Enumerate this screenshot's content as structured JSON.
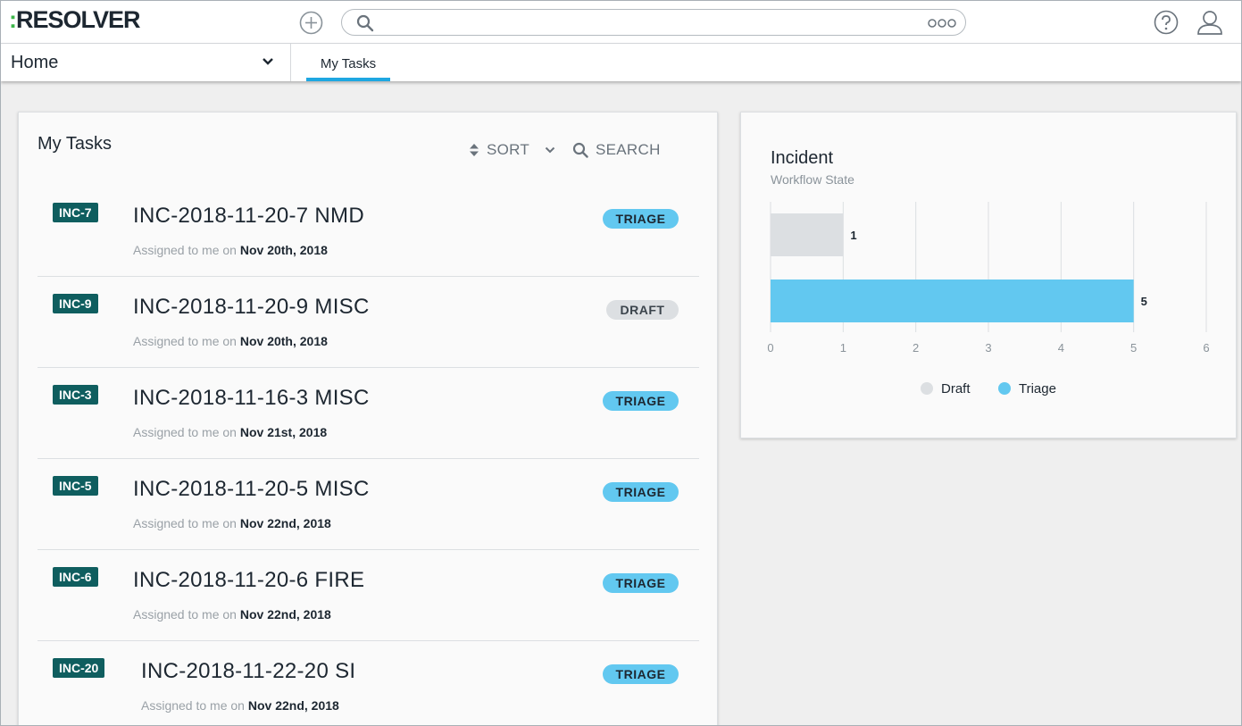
{
  "app": {
    "logo_colon": ":",
    "logo_text": "RESOLVER",
    "search_placeholder": ""
  },
  "nav": {
    "home_label": "Home",
    "active_tab": "My Tasks"
  },
  "tasks": {
    "title": "My Tasks",
    "sort_label": "SORT",
    "search_label": "SEARCH",
    "assigned_prefix": "Assigned to me on",
    "items": [
      {
        "id": "INC-7",
        "name": "INC-2018-11-20-7 NMD",
        "date": "Nov 20th, 2018",
        "state": "TRIAGE"
      },
      {
        "id": "INC-9",
        "name": "INC-2018-11-20-9 MISC",
        "date": "Nov 20th, 2018",
        "state": "DRAFT"
      },
      {
        "id": "INC-3",
        "name": "INC-2018-11-16-3 MISC",
        "date": "Nov 21st, 2018",
        "state": "TRIAGE"
      },
      {
        "id": "INC-5",
        "name": "INC-2018-11-20-5 MISC",
        "date": "Nov 22nd, 2018",
        "state": "TRIAGE"
      },
      {
        "id": "INC-6",
        "name": "INC-2018-11-20-6 FIRE",
        "date": "Nov 22nd, 2018",
        "state": "TRIAGE"
      },
      {
        "id": "INC-20",
        "name": "INC-2018-11-22-20 SI",
        "date": "Nov 22nd, 2018",
        "state": "TRIAGE"
      }
    ]
  },
  "chart_data": {
    "type": "bar",
    "orientation": "horizontal",
    "title": "Incident",
    "subtitle": "Workflow State",
    "categories": [
      "Draft",
      "Triage"
    ],
    "values": [
      1,
      5
    ],
    "colors": [
      "#dcdfe2",
      "#62c8f0"
    ],
    "xlim": [
      0,
      6
    ],
    "xticks": [
      0,
      1,
      2,
      3,
      4,
      5,
      6
    ],
    "grid": true,
    "legend": "bottom",
    "legend_items": [
      "Draft",
      "Triage"
    ]
  },
  "colors": {
    "accent": "#1ea7e1",
    "id_badge": "#0f5e5f",
    "triage": "#62c8f0",
    "draft": "#dcdfe2",
    "logo_colon": "#3cb649"
  }
}
